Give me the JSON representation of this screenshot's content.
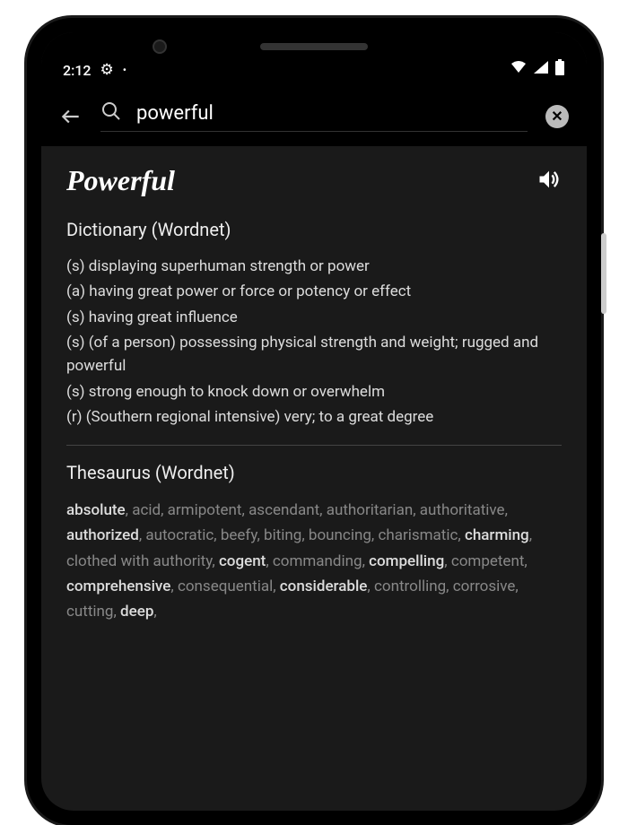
{
  "status": {
    "time": "2:12",
    "gear": "⚙",
    "dot": "•"
  },
  "search": {
    "value": "powerful"
  },
  "word": {
    "title": "Powerful"
  },
  "dictionary": {
    "heading": "Dictionary (Wordnet)",
    "items": [
      "(s) displaying superhuman strength or power",
      "(a) having great power or force or potency or effect",
      "(s) having great influence",
      "(s) (of a person) possessing physical strength and weight; rugged and powerful",
      "(s) strong enough to knock down or overwhelm",
      "(r) (Southern regional intensive) very; to a great degree"
    ]
  },
  "thesaurus": {
    "heading": "Thesaurus (Wordnet)",
    "items": [
      {
        "text": "absolute",
        "bold": true
      },
      {
        "text": "acid",
        "bold": false
      },
      {
        "text": "armipotent",
        "bold": false
      },
      {
        "text": "ascendant",
        "bold": false
      },
      {
        "text": "authoritarian",
        "bold": false
      },
      {
        "text": "authoritative",
        "bold": false
      },
      {
        "text": "authorized",
        "bold": true
      },
      {
        "text": "autocratic",
        "bold": false
      },
      {
        "text": "beefy",
        "bold": false
      },
      {
        "text": "biting",
        "bold": false
      },
      {
        "text": "bouncing",
        "bold": false
      },
      {
        "text": "charismatic",
        "bold": false
      },
      {
        "text": "charming",
        "bold": true
      },
      {
        "text": "clothed with authority",
        "bold": false
      },
      {
        "text": "cogent",
        "bold": true
      },
      {
        "text": "commanding",
        "bold": false
      },
      {
        "text": "compelling",
        "bold": true
      },
      {
        "text": "competent",
        "bold": false
      },
      {
        "text": "comprehensive",
        "bold": true
      },
      {
        "text": "consequential",
        "bold": false
      },
      {
        "text": "considerable",
        "bold": true
      },
      {
        "text": "controlling",
        "bold": false
      },
      {
        "text": "corrosive",
        "bold": false
      },
      {
        "text": "cutting",
        "bold": false
      },
      {
        "text": "deep",
        "bold": true
      }
    ]
  }
}
